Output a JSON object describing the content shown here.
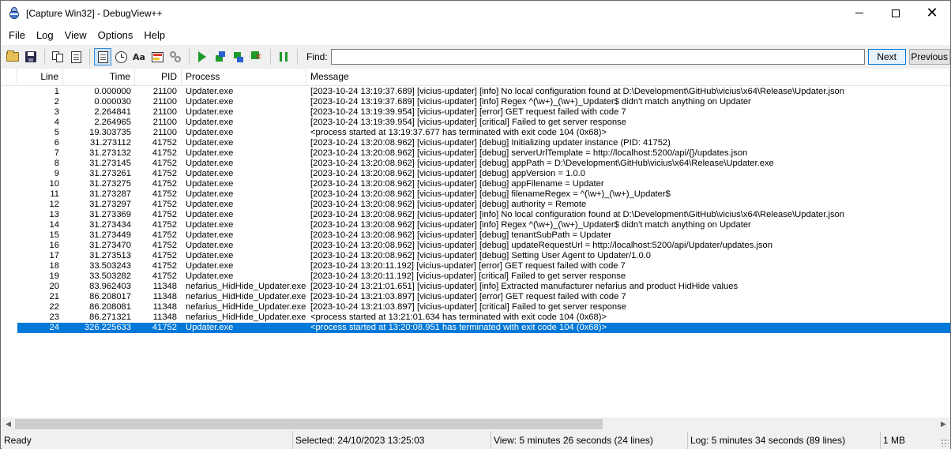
{
  "window": {
    "title": "[Capture Win32] - DebugView++",
    "controls": {
      "minimize": "",
      "maximize": "",
      "close": "✕"
    }
  },
  "menu": [
    "File",
    "Log",
    "View",
    "Options",
    "Help"
  ],
  "toolbar": {
    "icons": [
      "open-icon",
      "save-icon",
      "copy-icon",
      "copy-messages-icon",
      "autoscroll-icon",
      "clock-icon",
      "font-icon",
      "highlight-icon",
      "link-icon",
      "run-icon",
      "process-up-icon",
      "process-down-icon",
      "stop-icon",
      "pause-icon"
    ],
    "find_label": "Find:",
    "find_value": "",
    "next_label": "Next",
    "previous_label": "Previous"
  },
  "columns": {
    "line": "Line",
    "time": "Time",
    "pid": "PID",
    "process": "Process",
    "message": "Message"
  },
  "rows": [
    {
      "line": "1",
      "time": "0.000000",
      "pid": "21100",
      "process": "Updater.exe",
      "message": "[2023-10-24 13:19:37.689] [vicius-updater] [info] No local configuration found at D:\\Development\\GitHub\\vicius\\x64\\Release\\Updater.json"
    },
    {
      "line": "2",
      "time": "0.000030",
      "pid": "21100",
      "process": "Updater.exe",
      "message": "[2023-10-24 13:19:37.689] [vicius-updater] [info] Regex ^(\\w+)_(\\w+)_Updater$ didn't match anything on Updater"
    },
    {
      "line": "3",
      "time": "2.264841",
      "pid": "21100",
      "process": "Updater.exe",
      "message": "[2023-10-24 13:19:39.954] [vicius-updater] [error] GET request failed with code 7"
    },
    {
      "line": "4",
      "time": "2.264965",
      "pid": "21100",
      "process": "Updater.exe",
      "message": "[2023-10-24 13:19:39.954] [vicius-updater] [critical] Failed to get server response"
    },
    {
      "line": "5",
      "time": "19.303735",
      "pid": "21100",
      "process": "Updater.exe",
      "message": "<process started at 13:19:37.677 has terminated with exit code 104 (0x68)>"
    },
    {
      "line": "6",
      "time": "31.273112",
      "pid": "41752",
      "process": "Updater.exe",
      "message": "[2023-10-24 13:20:08.962] [vicius-updater] [debug] Initializing updater instance (PID: 41752)"
    },
    {
      "line": "7",
      "time": "31.273132",
      "pid": "41752",
      "process": "Updater.exe",
      "message": "[2023-10-24 13:20:08.962] [vicius-updater] [debug] serverUrlTemplate = http://localhost:5200/api/{}/updates.json"
    },
    {
      "line": "8",
      "time": "31.273145",
      "pid": "41752",
      "process": "Updater.exe",
      "message": "[2023-10-24 13:20:08.962] [vicius-updater] [debug] appPath = D:\\Development\\GitHub\\vicius\\x64\\Release\\Updater.exe"
    },
    {
      "line": "9",
      "time": "31.273261",
      "pid": "41752",
      "process": "Updater.exe",
      "message": "[2023-10-24 13:20:08.962] [vicius-updater] [debug] appVersion = 1.0.0"
    },
    {
      "line": "10",
      "time": "31.273275",
      "pid": "41752",
      "process": "Updater.exe",
      "message": "[2023-10-24 13:20:08.962] [vicius-updater] [debug] appFilename = Updater"
    },
    {
      "line": "11",
      "time": "31.273287",
      "pid": "41752",
      "process": "Updater.exe",
      "message": "[2023-10-24 13:20:08.962] [vicius-updater] [debug] filenameRegex = ^(\\w+)_(\\w+)_Updater$"
    },
    {
      "line": "12",
      "time": "31.273297",
      "pid": "41752",
      "process": "Updater.exe",
      "message": "[2023-10-24 13:20:08.962] [vicius-updater] [debug] authority = Remote"
    },
    {
      "line": "13",
      "time": "31.273369",
      "pid": "41752",
      "process": "Updater.exe",
      "message": "[2023-10-24 13:20:08.962] [vicius-updater] [info] No local configuration found at D:\\Development\\GitHub\\vicius\\x64\\Release\\Updater.json"
    },
    {
      "line": "14",
      "time": "31.273434",
      "pid": "41752",
      "process": "Updater.exe",
      "message": "[2023-10-24 13:20:08.962] [vicius-updater] [info] Regex ^(\\w+)_(\\w+)_Updater$ didn't match anything on Updater"
    },
    {
      "line": "15",
      "time": "31.273449",
      "pid": "41752",
      "process": "Updater.exe",
      "message": "[2023-10-24 13:20:08.962] [vicius-updater] [debug] tenantSubPath = Updater"
    },
    {
      "line": "16",
      "time": "31.273470",
      "pid": "41752",
      "process": "Updater.exe",
      "message": "[2023-10-24 13:20:08.962] [vicius-updater] [debug] updateRequestUrl = http://localhost:5200/api/Updater/updates.json"
    },
    {
      "line": "17",
      "time": "31.273513",
      "pid": "41752",
      "process": "Updater.exe",
      "message": "[2023-10-24 13:20:08.962] [vicius-updater] [debug] Setting User Agent to Updater/1.0.0"
    },
    {
      "line": "18",
      "time": "33.503243",
      "pid": "41752",
      "process": "Updater.exe",
      "message": "[2023-10-24 13:20:11.192] [vicius-updater] [error] GET request failed with code 7"
    },
    {
      "line": "19",
      "time": "33.503282",
      "pid": "41752",
      "process": "Updater.exe",
      "message": "[2023-10-24 13:20:11.192] [vicius-updater] [critical] Failed to get server response"
    },
    {
      "line": "20",
      "time": "83.962403",
      "pid": "11348",
      "process": "nefarius_HidHide_Updater.exe",
      "message": "[2023-10-24 13:21:01.651] [vicius-updater] [info] Extracted manufacturer nefarius and product HidHide values"
    },
    {
      "line": "21",
      "time": "86.208017",
      "pid": "11348",
      "process": "nefarius_HidHide_Updater.exe",
      "message": "[2023-10-24 13:21:03.897] [vicius-updater] [error] GET request failed with code 7"
    },
    {
      "line": "22",
      "time": "86.208081",
      "pid": "11348",
      "process": "nefarius_HidHide_Updater.exe",
      "message": "[2023-10-24 13:21:03.897] [vicius-updater] [critical] Failed to get server response"
    },
    {
      "line": "23",
      "time": "86.271321",
      "pid": "11348",
      "process": "nefarius_HidHide_Updater.exe",
      "message": "<process started at 13:21:01.634 has terminated with exit code 104 (0x68)>"
    },
    {
      "line": "24",
      "time": "326.225633",
      "pid": "41752",
      "process": "Updater.exe",
      "message": "<process started at 13:20:08.951 has terminated with exit code 104 (0x68)>",
      "selected": true
    }
  ],
  "scrollbar": {
    "left_arrow": "◀",
    "right_arrow": "▶"
  },
  "status": {
    "ready": "Ready",
    "selected": "Selected: 24/10/2023 13:25:03",
    "view": "View: 5 minutes 26 seconds (24 lines)",
    "log": "Log: 5 minutes 34 seconds (89 lines)",
    "memory": "1 MB"
  },
  "colors": {
    "selection": "#0078d7",
    "accent": "#0078d7"
  }
}
